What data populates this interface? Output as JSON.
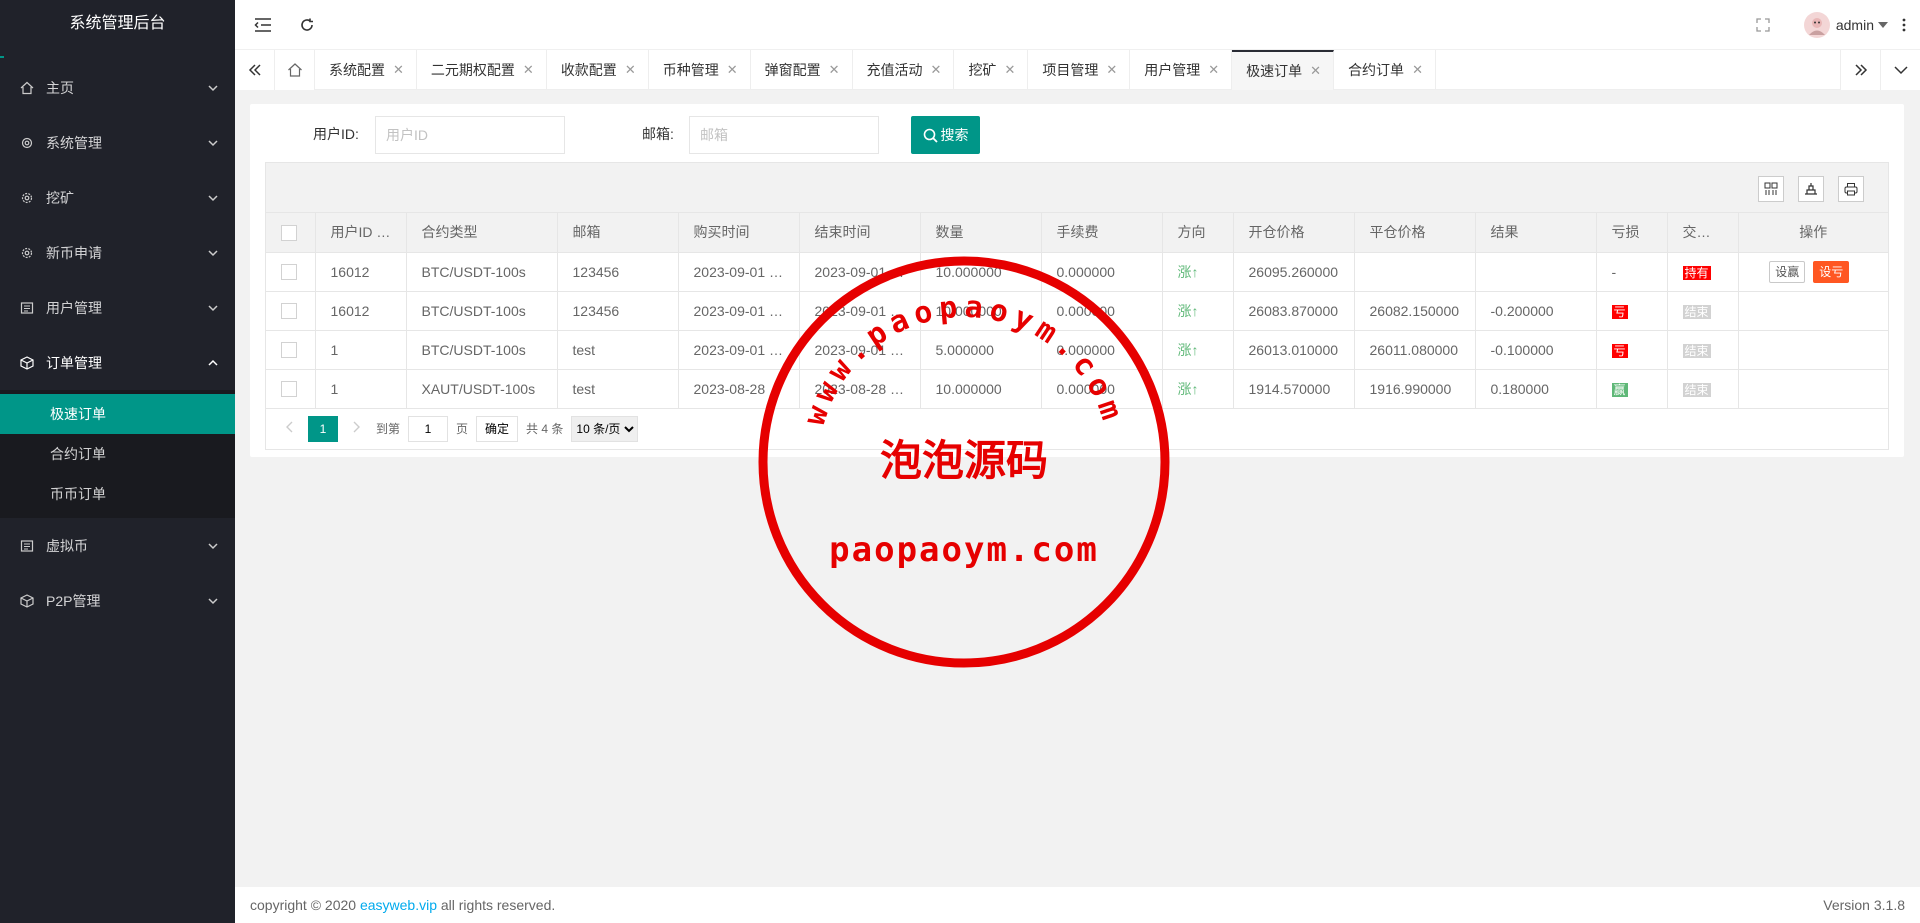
{
  "app": {
    "title": "系统管理后台"
  },
  "sidebar": {
    "items": [
      {
        "label": "主页",
        "icon": "home-icon"
      },
      {
        "label": "系统管理",
        "icon": "gear-icon"
      },
      {
        "label": "挖矿",
        "icon": "gear-icon"
      },
      {
        "label": "新币申请",
        "icon": "gear-icon"
      },
      {
        "label": "用户管理",
        "icon": "list-icon"
      },
      {
        "label": "订单管理",
        "icon": "cube-icon",
        "expanded": true,
        "children": [
          {
            "label": "极速订单",
            "active": true
          },
          {
            "label": "合约订单"
          },
          {
            "label": "币币订单"
          }
        ]
      },
      {
        "label": "虚拟币",
        "icon": "list-icon"
      },
      {
        "label": "P2P管理",
        "icon": "cube-icon"
      }
    ]
  },
  "header": {
    "username": "admin"
  },
  "tabs": [
    {
      "label": "系统配置"
    },
    {
      "label": "二元期权配置"
    },
    {
      "label": "收款配置"
    },
    {
      "label": "币种管理"
    },
    {
      "label": "弹窗配置"
    },
    {
      "label": "充值活动"
    },
    {
      "label": "挖矿"
    },
    {
      "label": "项目管理"
    },
    {
      "label": "用户管理"
    },
    {
      "label": "极速订单",
      "active": true
    },
    {
      "label": "合约订单"
    }
  ],
  "search": {
    "user_id_label": "用户ID:",
    "user_id_placeholder": "用户ID",
    "email_label": "邮箱:",
    "email_placeholder": "邮箱",
    "button_label": "搜索"
  },
  "table": {
    "columns": [
      "用户ID",
      "合约类型",
      "邮箱",
      "购买时间",
      "结束时间",
      "数量",
      "手续费",
      "方向",
      "开仓价格",
      "平仓价格",
      "结果",
      "亏损",
      "交…",
      "操作"
    ],
    "rows": [
      {
        "user_id": "16012",
        "contract": "BTC/USDT-100s",
        "email": "123456",
        "buy_time": "2023-09-01 …",
        "end_time": "2023-09-01 …",
        "qty": "10.000000",
        "fee": "0.000000",
        "direction": "涨↑",
        "open_price": "26095.260000",
        "close_price": "",
        "result": "",
        "pnl": "-",
        "pnl_tag": "",
        "status": "持有",
        "status_color": "red",
        "actions": [
          "设赢",
          "设亏"
        ]
      },
      {
        "user_id": "16012",
        "contract": "BTC/USDT-100s",
        "email": "123456",
        "buy_time": "2023-09-01 …",
        "end_time": "2023-09-01 …",
        "qty": "10.000000",
        "fee": "0.000000",
        "direction": "涨↑",
        "open_price": "26083.870000",
        "close_price": "26082.150000",
        "result": "-0.200000",
        "pnl": "",
        "pnl_tag": "亏",
        "pnl_color": "red",
        "status": "结束",
        "status_color": "gray",
        "actions": []
      },
      {
        "user_id": "1",
        "contract": "BTC/USDT-100s",
        "email": "test",
        "buy_time": "2023-09-01 …",
        "end_time": "2023-09-01 …",
        "qty": "5.000000",
        "fee": "0.000000",
        "direction": "涨↑",
        "open_price": "26013.010000",
        "close_price": "26011.080000",
        "result": "-0.100000",
        "pnl": "",
        "pnl_tag": "亏",
        "pnl_color": "red",
        "status": "结束",
        "status_color": "gray",
        "actions": []
      },
      {
        "user_id": "1",
        "contract": "XAUT/USDT-100s",
        "email": "test",
        "buy_time": "2023-08-28",
        "end_time": "2023-08-28 …",
        "qty": "10.000000",
        "fee": "0.000000",
        "direction": "涨↑",
        "open_price": "1914.570000",
        "close_price": "1916.990000",
        "result": "0.180000",
        "pnl": "",
        "pnl_tag": "赢",
        "pnl_color": "green",
        "status": "结束",
        "status_color": "gray",
        "actions": []
      }
    ]
  },
  "pager": {
    "current_page": "1",
    "goto_prefix": "到第",
    "goto_value": "1",
    "goto_suffix": "页",
    "confirm_label": "确定",
    "total_text": "共 4 条",
    "page_size": "10 条/页"
  },
  "footer": {
    "copyright_prefix": "copyright © 2020 ",
    "link_text": "easyweb.vip",
    "copyright_suffix": " all rights reserved.",
    "version": "Version 3.1.8"
  },
  "watermark": {
    "arc_text": "www.paopaoym.com",
    "center_text": "泡泡源码",
    "bottom_text": "paopaoym.com",
    "color": "#e60000"
  },
  "colors": {
    "accent": "#009688",
    "sidebar_bg": "#20222a",
    "danger": "#FF5722"
  }
}
